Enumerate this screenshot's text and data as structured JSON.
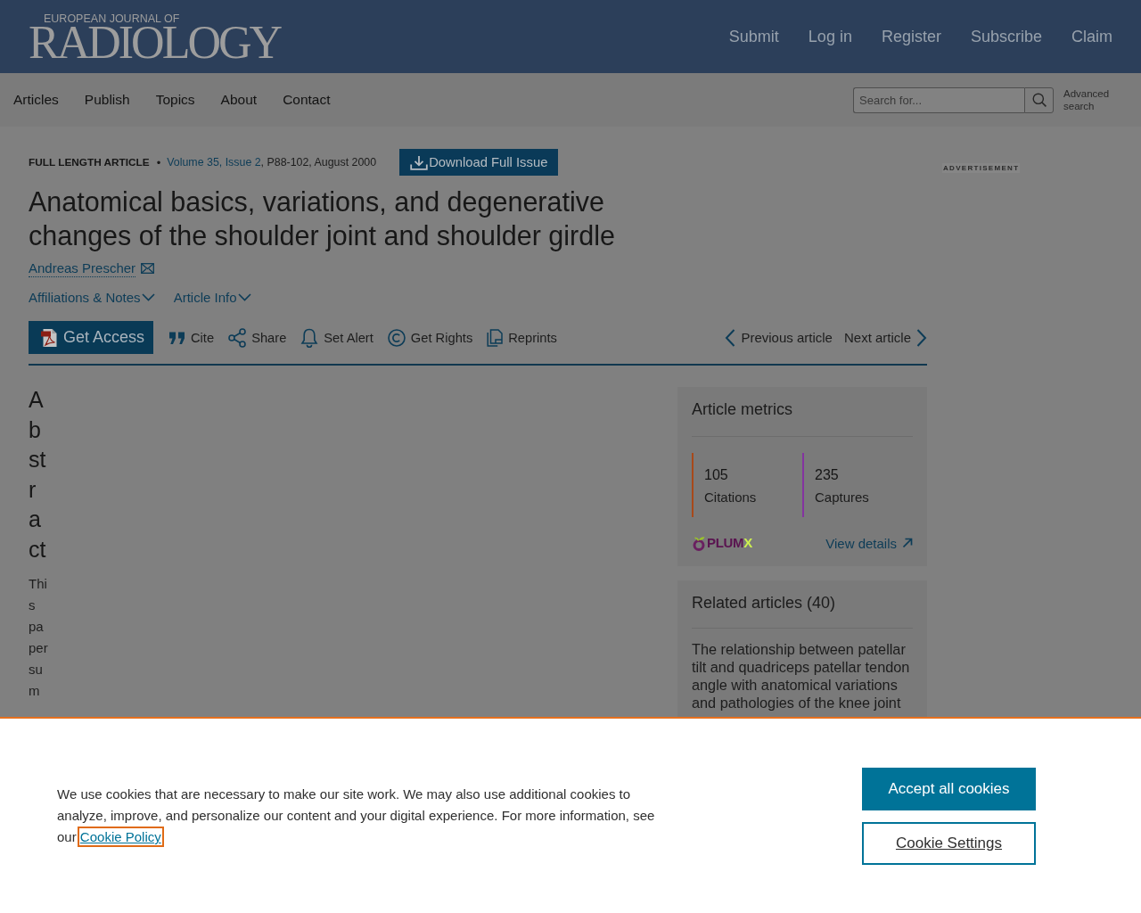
{
  "header": {
    "logo": {
      "kicker": "EUROPEAN JOURNAL OF",
      "wordmark": "RADIOLOGY"
    },
    "links": [
      "Submit",
      "Log in",
      "Register",
      "Subscribe",
      "Claim"
    ]
  },
  "nav": {
    "items": [
      "Articles",
      "Publish",
      "Topics",
      "About",
      "Contact"
    ],
    "search": {
      "placeholder": "Search for..."
    },
    "advanced_search": "Advanced search"
  },
  "article": {
    "type": "FULL LENGTH ARTICLE",
    "separator": "•",
    "citation": {
      "link": "Volume 35, Issue 2",
      "rest": ", P88-102, August 2000"
    },
    "download_button": "Download Full Issue",
    "title": "Anatomical basics, variations, and degenerative changes of the shoulder joint and shoulder girdle",
    "authors": [
      "Andreas Prescher"
    ],
    "disclosures": [
      "Affiliations & Notes",
      "Article Info"
    ],
    "actions": [
      {
        "kind": "access",
        "label": "Get Access"
      },
      {
        "kind": "cite",
        "label": "Cite"
      },
      {
        "kind": "share",
        "label": "Share"
      },
      {
        "kind": "alert",
        "label": "Set Alert"
      },
      {
        "kind": "rights",
        "label": "Get Rights"
      },
      {
        "kind": "reprints",
        "label": "Reprints"
      }
    ],
    "pager": {
      "previous": "Previous article",
      "next": "Next article"
    }
  },
  "abstract": {
    "heading": "Abstract",
    "text": "This paper sum"
  },
  "sidebar": {
    "metrics": {
      "title": "Article metrics",
      "items": [
        {
          "value": "105",
          "label": "Citations",
          "color": "#a8491a"
        },
        {
          "value": "235",
          "label": "Captures",
          "color": "#8433a0"
        }
      ],
      "logo": {
        "main": "PLUM",
        "accent": "X"
      },
      "link": "View details"
    },
    "related": {
      "title": "Related articles (40)",
      "items": [
        "The relationship between patellar tilt and quadriceps patellar tendon angle with anatomical variations and pathologies of the knee joint"
      ]
    }
  },
  "advertisement": {
    "label": "ADVERTISEMENT"
  },
  "cookie_banner": {
    "text": "We use cookies that are necessary to make our site work. We may also use additional cookies to analyze, improve, and personalize our content and your digital experience. For more information, see our",
    "link": {
      "label": "Cookie Policy",
      "focused": true
    },
    "buttons": [
      {
        "kind": "primary",
        "label": "Accept all cookies"
      },
      {
        "kind": "secondary",
        "label": "Cookie Settings"
      }
    ]
  }
}
